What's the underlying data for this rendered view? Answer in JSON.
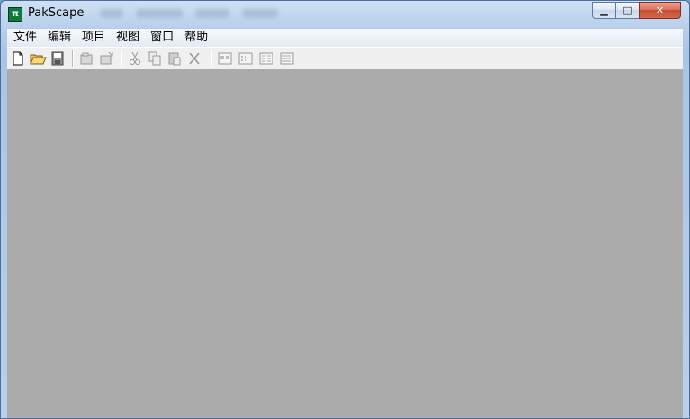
{
  "window": {
    "title": "PakScape"
  },
  "titlebar": {
    "icon": "pakscape-app-icon",
    "controls": {
      "minimize": "minimize-icon",
      "maximize": "maximize-icon",
      "close": "close-icon"
    }
  },
  "menu": {
    "items": [
      {
        "label": "文件"
      },
      {
        "label": "编辑"
      },
      {
        "label": "项目"
      },
      {
        "label": "视图"
      },
      {
        "label": "窗口"
      },
      {
        "label": "帮助"
      }
    ]
  },
  "toolbar": {
    "buttons": [
      {
        "icon": "new-file-icon",
        "enabled": true
      },
      {
        "icon": "open-folder-icon",
        "enabled": true
      },
      {
        "icon": "save-icon",
        "enabled": true
      },
      {
        "icon": "add-files-icon",
        "enabled": false
      },
      {
        "icon": "extract-icon",
        "enabled": false
      },
      {
        "icon": "cut-icon",
        "enabled": false
      },
      {
        "icon": "copy-icon",
        "enabled": false
      },
      {
        "icon": "paste-icon",
        "enabled": false
      },
      {
        "icon": "delete-icon",
        "enabled": false
      },
      {
        "icon": "large-icons-view-icon",
        "enabled": false
      },
      {
        "icon": "small-icons-view-icon",
        "enabled": false
      },
      {
        "icon": "list-view-icon",
        "enabled": false
      },
      {
        "icon": "details-view-icon",
        "enabled": false
      }
    ]
  },
  "colors": {
    "client_area": "#ababab",
    "titlebar": "#b9d1ec",
    "close_button": "#c5492e"
  }
}
